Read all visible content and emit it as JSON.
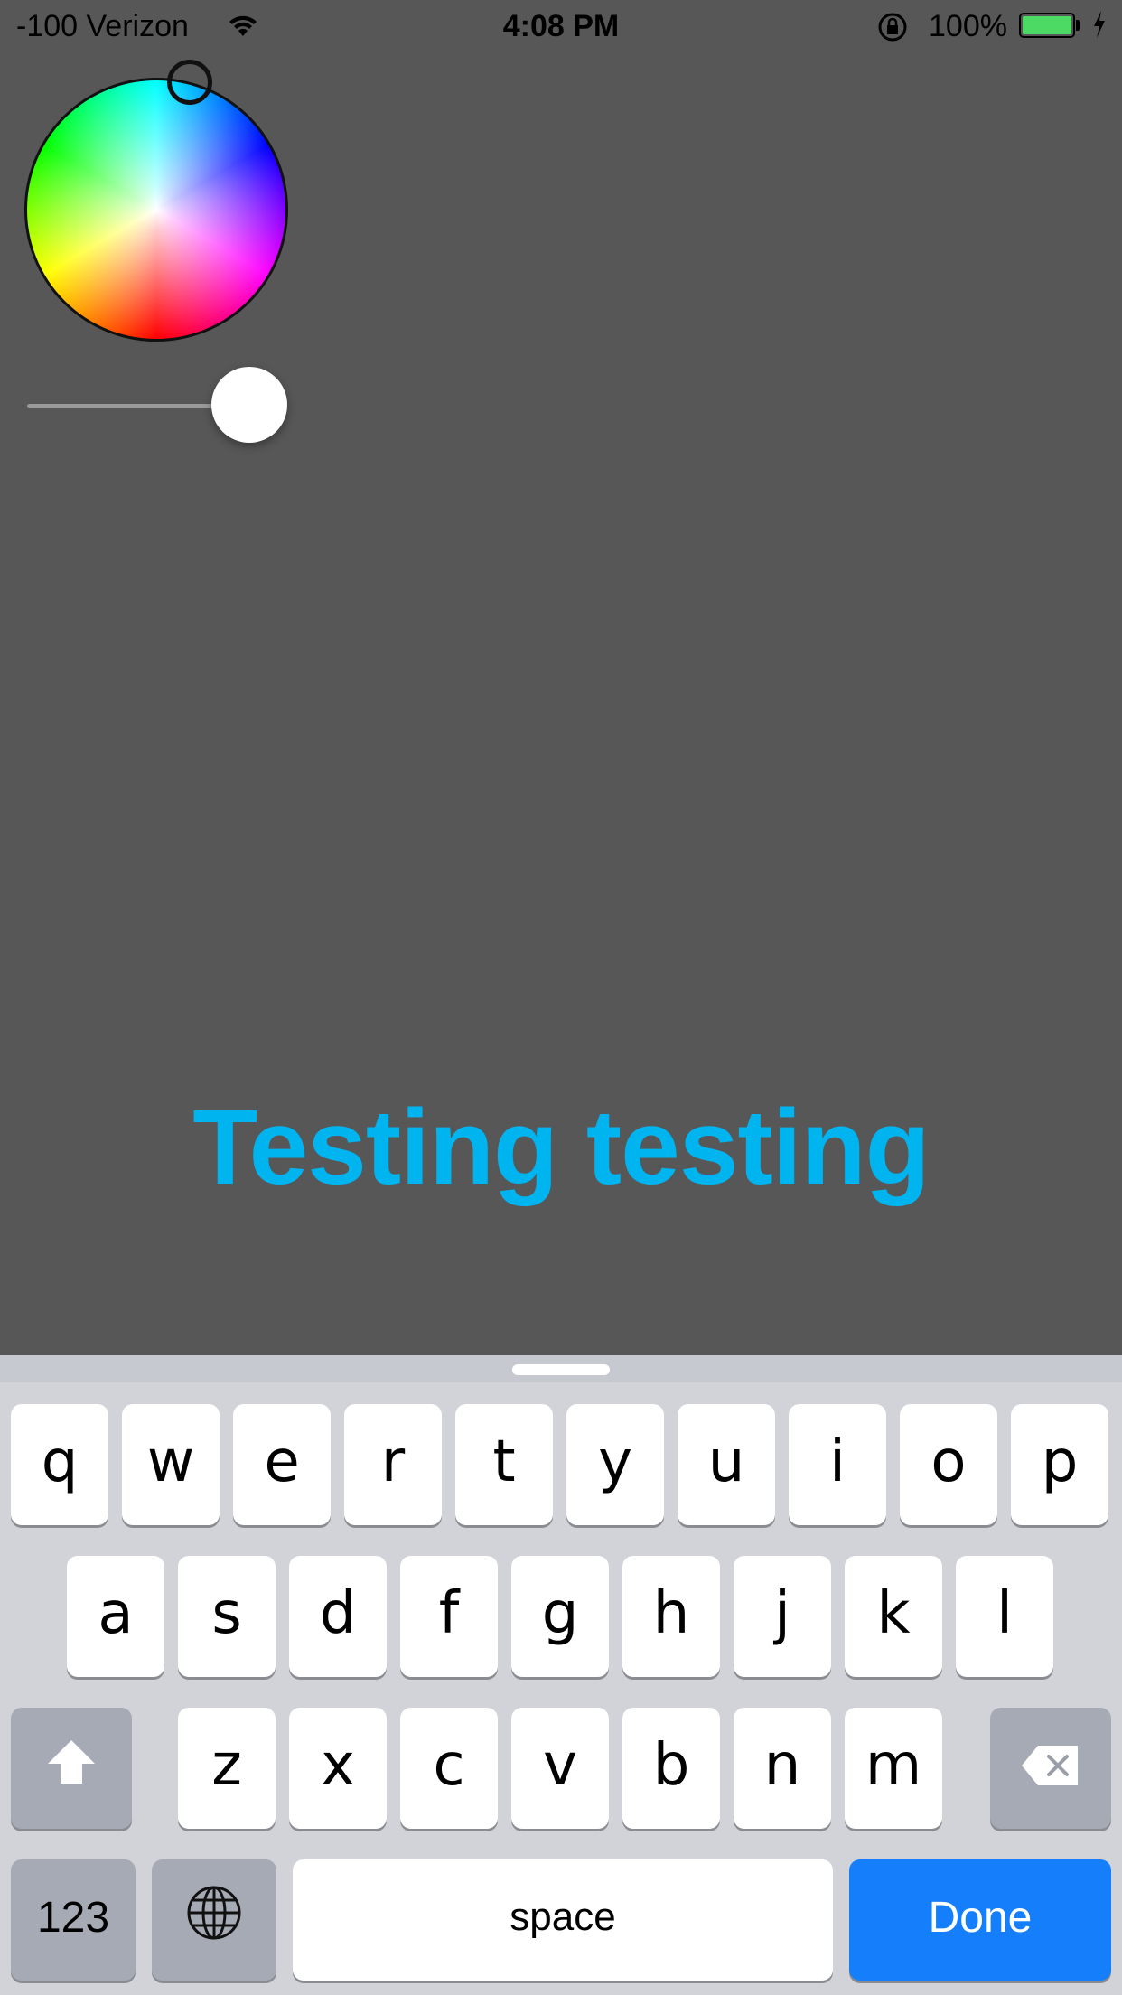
{
  "status_bar": {
    "carrier": "-100 Verizon",
    "time": "4:08 PM",
    "battery_percent": "100%",
    "battery_color": "#4cd964"
  },
  "color_picker": {
    "selected_hue_label": "cyan",
    "brightness_level": 1.0
  },
  "preview": {
    "text": "Testing testing",
    "color": "#00b4f0"
  },
  "keyboard": {
    "row1": [
      "q",
      "w",
      "e",
      "r",
      "t",
      "y",
      "u",
      "i",
      "o",
      "p"
    ],
    "row2": [
      "a",
      "s",
      "d",
      "f",
      "g",
      "h",
      "j",
      "k",
      "l"
    ],
    "row3": [
      "z",
      "x",
      "c",
      "v",
      "b",
      "n",
      "m"
    ],
    "numbers_label": "123",
    "space_label": "space",
    "done_label": "Done",
    "done_color": "#147efb"
  }
}
